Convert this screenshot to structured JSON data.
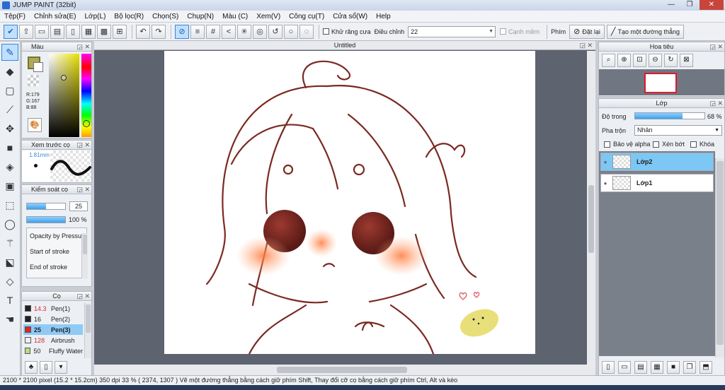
{
  "window": {
    "title": "JUMP PAINT (32bit)",
    "min": "—",
    "max": "❐",
    "close": "✕"
  },
  "menu": [
    "Tệp(F)",
    "Chỉnh sửa(E)",
    "Lớp(L)",
    "Bộ lọc(R)",
    "Chọn(S)",
    "Chụp(N)",
    "Màu (C)",
    "Xem(V)",
    "Công cụ(T)",
    "Cửa sổ(W)",
    "Help"
  ],
  "toolbar": {
    "antialias_label": "Khử răng cưa",
    "adjust_label": "Điều chỉnh",
    "adjust_value": "22",
    "canh_mem_label": "Cạnh mềm",
    "pen_label": "Phím",
    "reset_label": "Đặt lại",
    "line_label": "Tạo một đường thẳng"
  },
  "color_panel": {
    "title": "Màu",
    "rgb": [
      "R:179",
      "G:167",
      "B:88"
    ],
    "color": "#b3a758"
  },
  "brush_preview": {
    "title": "Xem trước cọ",
    "size": "1.81mm"
  },
  "brush_control": {
    "title": "Kiểm soát cọ",
    "size_value": "25",
    "opacity_value": "100 %",
    "options": [
      "Opacity by Pressure",
      "Start of stroke",
      "End of stroke"
    ]
  },
  "brush_list": {
    "title": "Cọ",
    "items": [
      {
        "size": "14.3",
        "name": "Pen(1)",
        "color": "#222222",
        "size_color": "#d03030"
      },
      {
        "size": "16",
        "name": "Pen(2)",
        "color": "#222222",
        "size_color": "#111111"
      },
      {
        "size": "25",
        "name": "Pen(3)",
        "color": "#e02525",
        "size_color": "#111111"
      },
      {
        "size": "128",
        "name": "Airbrush",
        "color": "#eeeeee",
        "size_color": "#d03030"
      },
      {
        "size": "50",
        "name": "Fluffy Water",
        "color": "#b8e07a",
        "size_color": "#111111"
      }
    ]
  },
  "document": {
    "tab": "Untitled"
  },
  "navigator": {
    "title": "Hoa tiêu"
  },
  "layers": {
    "title": "Lớp",
    "opacity_label": "Độ trong",
    "opacity_value": "68 %",
    "opacity_fraction": 0.68,
    "blend_label": "Pha trộn",
    "blend_value": "Nhân",
    "protect_alpha": "Bảo vệ alpha",
    "clip": "Xén bớt",
    "lock": "Khóa",
    "items": [
      {
        "name": "Lớp2",
        "selected": true
      },
      {
        "name": "Lớp1",
        "selected": false
      }
    ]
  },
  "status": {
    "text": "2100 * 2100 pixel  (15.2 * 15.2cm)  350 dpi  33 %  ( 2374, 1307 )  Vẽ một đường thẳng bằng cách giữ phím Shift, Thay đổi cỡ cọ bằng cách giữ phím Ctrl, Alt và kéo"
  },
  "icons": [
    "brush-icon",
    "eraser-icon",
    "select-icon",
    "line-icon",
    "move-icon",
    "fill-icon",
    "bucket-icon",
    "gradient-icon",
    "lasso-icon",
    "wand-icon",
    "eyedropper-icon",
    "text-icon",
    "hand-icon"
  ]
}
